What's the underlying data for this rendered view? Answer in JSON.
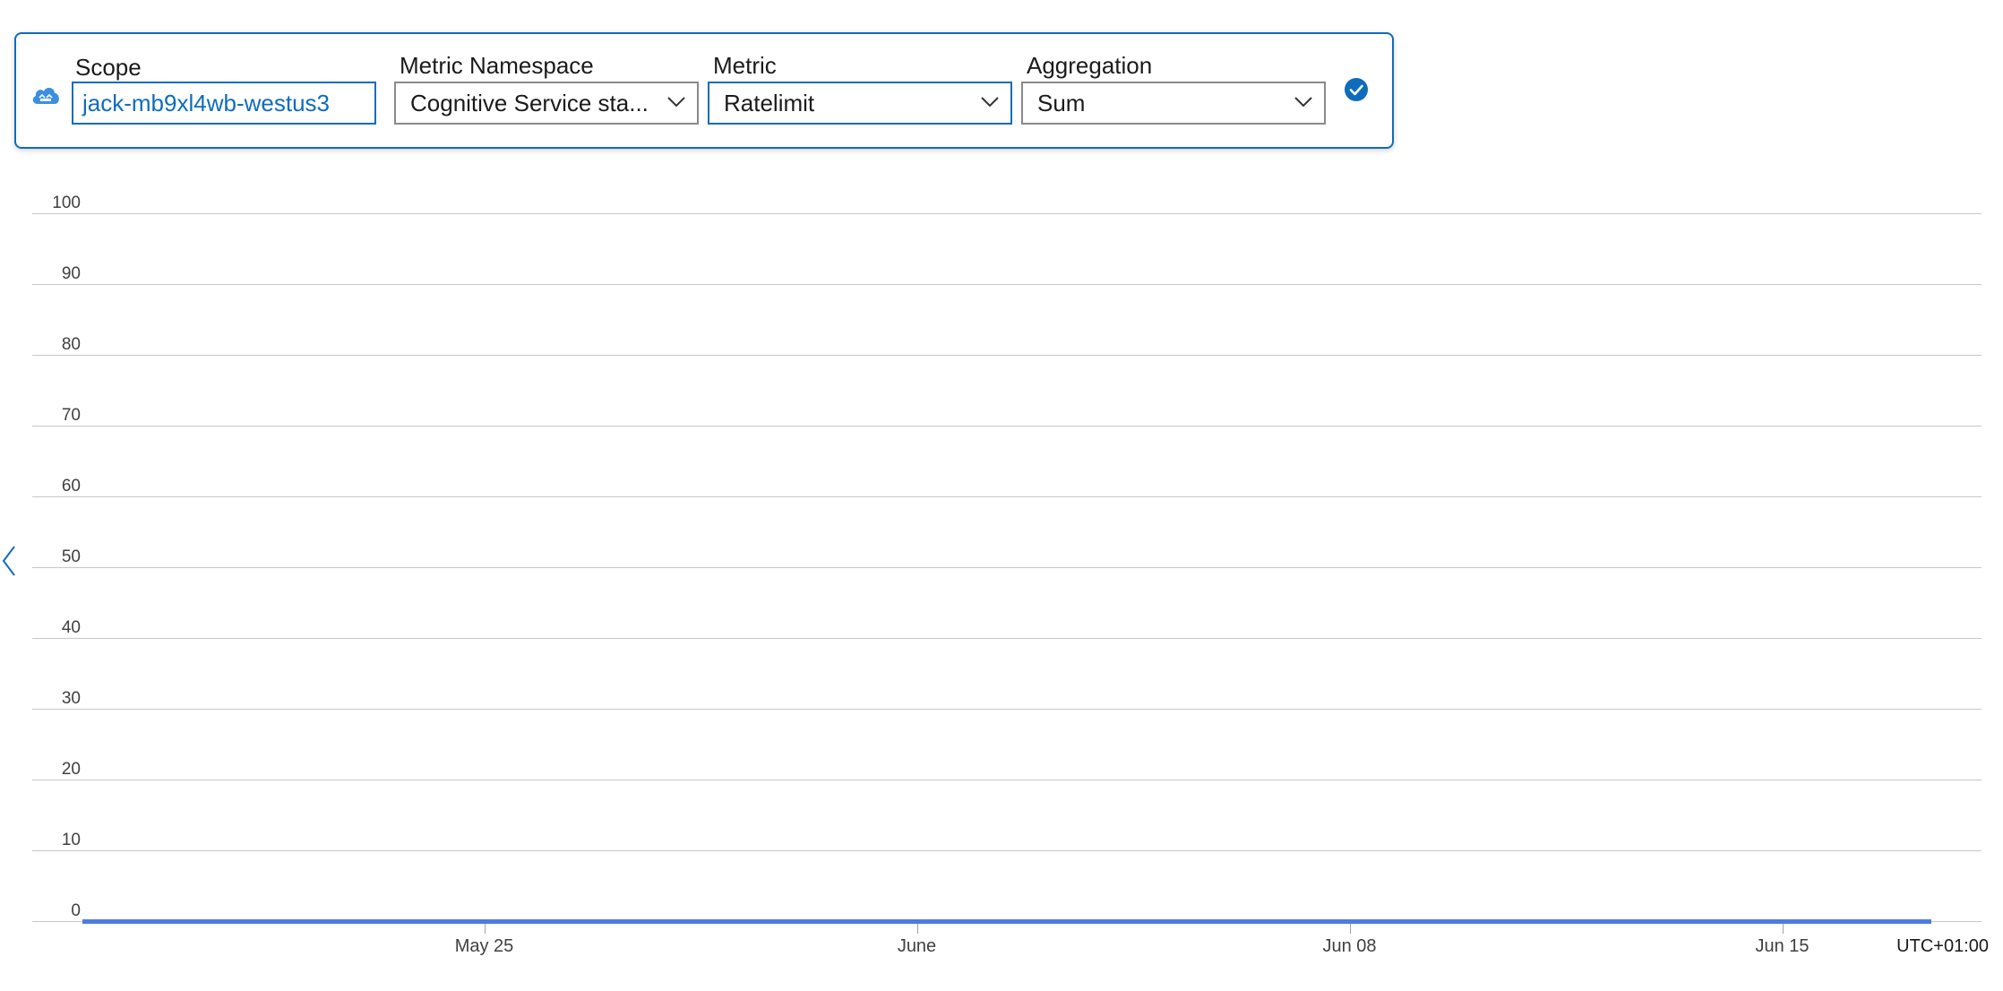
{
  "picker": {
    "scope_label": "Scope",
    "scope_value": "jack-mb9xl4wb-westus3",
    "namespace_label": "Metric Namespace",
    "namespace_value": "Cognitive Service sta...",
    "metric_label": "Metric",
    "metric_value": "Ratelimit",
    "aggregation_label": "Aggregation",
    "aggregation_value": "Sum",
    "icons": [
      "cloud-resource-icon",
      "chevron-down-icon",
      "check-circle-icon"
    ],
    "accent_color": "#0f6cbd"
  },
  "chart_data": {
    "type": "line",
    "title": "",
    "xlabel": "",
    "ylabel": "",
    "ylim": [
      0,
      100
    ],
    "y_ticks": [
      "100",
      "90",
      "80",
      "70",
      "60",
      "50",
      "40",
      "30",
      "20",
      "10",
      "0"
    ],
    "x_ticks": [
      "May 25",
      "June",
      "Jun 08",
      "Jun 15"
    ],
    "timezone": "UTC+01:00",
    "grid": true,
    "series": [
      {
        "color": "#4f7ae0",
        "x": [
          "2025-05-19",
          "2025-06-19"
        ],
        "values": [
          0,
          0
        ]
      }
    ]
  },
  "nav": {
    "collapse_icon": "chevron-left-icon"
  }
}
